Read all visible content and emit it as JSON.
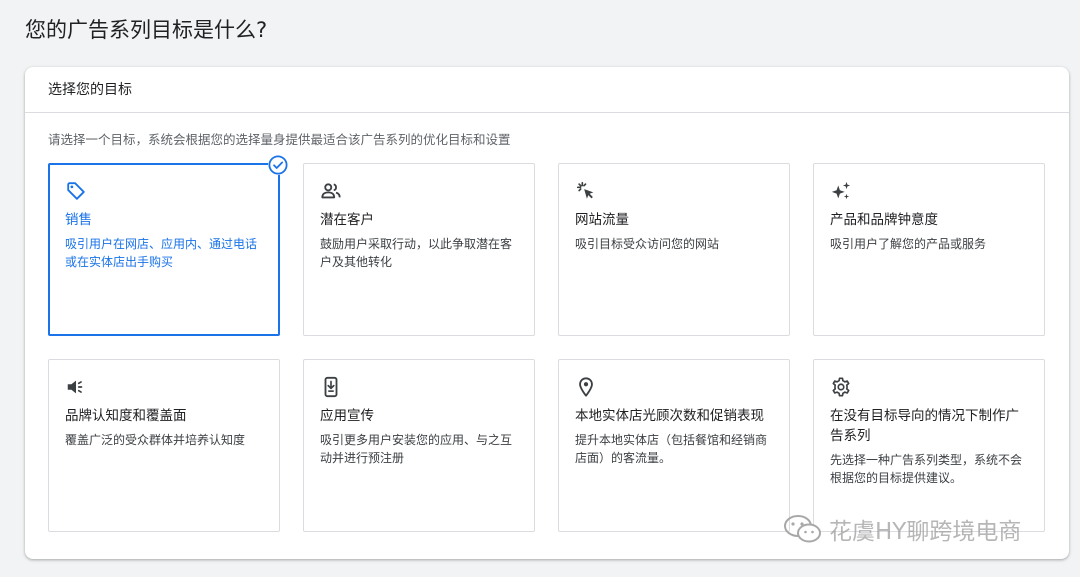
{
  "page": {
    "title": "您的广告系列目标是什么?"
  },
  "panel": {
    "header": "选择您的目标",
    "description": "请选择一个目标，系统会根据您的选择量身提供最适合该广告系列的优化目标和设置"
  },
  "goals": [
    {
      "icon": "tag-icon",
      "title": "销售",
      "desc": "吸引用户在网店、应用内、通过电话或在实体店出手购买",
      "selected": true
    },
    {
      "icon": "people-icon",
      "title": "潜在客户",
      "desc": "鼓励用户采取行动，以此争取潜在客户及其他转化",
      "selected": false
    },
    {
      "icon": "cursor-click-icon",
      "title": "网站流量",
      "desc": "吸引目标受众访问您的网站",
      "selected": false
    },
    {
      "icon": "sparkle-icon",
      "title": "产品和品牌钟意度",
      "desc": "吸引用户了解您的产品或服务",
      "selected": false
    },
    {
      "icon": "megaphone-icon",
      "title": "品牌认知度和覆盖面",
      "desc": "覆盖广泛的受众群体并培养认知度",
      "selected": false
    },
    {
      "icon": "phone-download-icon",
      "title": "应用宣传",
      "desc": "吸引更多用户安装您的应用、与之互动并进行预注册",
      "selected": false
    },
    {
      "icon": "location-pin-icon",
      "title": "本地实体店光顾次数和促销表现",
      "desc": "提升本地实体店（包括餐馆和经销商店面）的客流量。",
      "selected": false
    },
    {
      "icon": "gear-icon",
      "title": "在没有目标导向的情况下制作广告系列",
      "desc": "先选择一种广告系列类型，系统不会根据您的目标提供建议。",
      "selected": false
    }
  ],
  "watermark": {
    "text": "花虞HY聊跨境电商"
  },
  "colors": {
    "accent": "#1a73e8",
    "border": "#dadce0",
    "text": "#202124"
  }
}
